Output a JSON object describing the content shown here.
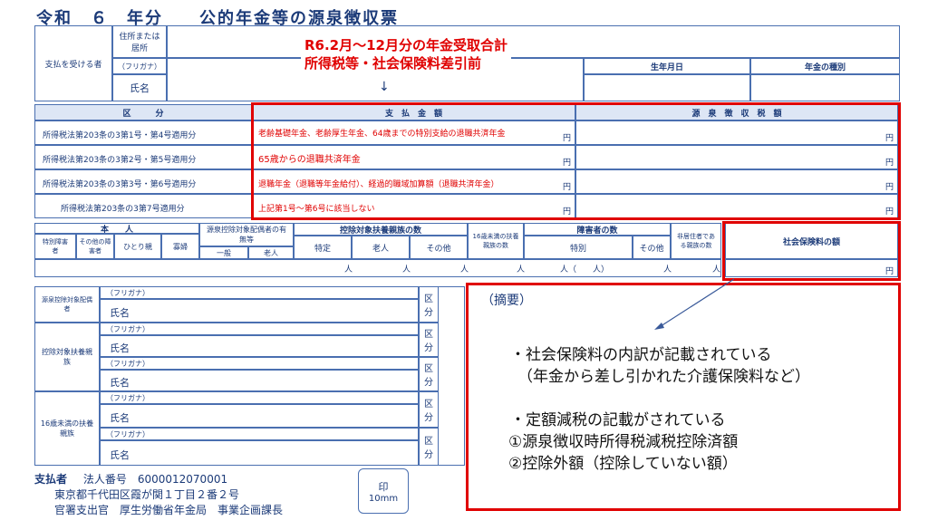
{
  "doc": {
    "title": "令和　６　年分　　公的年金等の源泉徴収票"
  },
  "payee": {
    "label": "支払を受ける者",
    "address_label": "住所または居所",
    "furigana_label": "（フリガナ）",
    "name_label": "氏名",
    "birth_label": "生年月日",
    "type_label": "年金の種別"
  },
  "note": {
    "line1": "R6.2月～12月分の年金受取合計",
    "line2": "所得税等・社会保険料差引前",
    "arrow": "↓"
  },
  "table": {
    "kubun": "区　　　分",
    "payment": "支　払　金　額",
    "withholding": "源　泉　徴　収　税　額",
    "yen": "円",
    "rows": [
      {
        "label": "所得税法第203条の3第1号・第4号適用分",
        "content": "老齢基礎年金、老齢厚生年金、64歳までの特別支給の退職共済年金"
      },
      {
        "label": "所得税法第203条の3第2号・第5号適用分",
        "content": "65歳からの退職共済年金"
      },
      {
        "label": "所得税法第203条の3第3号・第6号適用分",
        "content": "退職年金（退職等年金給付）、経過的職域加算額（退職共済年金）"
      },
      {
        "label": "所得税法第203条の3第7号適用分",
        "content": "上記第1号～第6号に該当しない"
      }
    ]
  },
  "deps": {
    "honnin": "本　　人",
    "tokubetsu": "特別障害者",
    "sonota": "その他の障害者",
    "hitorioya": "ひとり親",
    "kafu": "寡婦",
    "spouse": "源泉控除対象配偶者の有無等",
    "ippan": "一般",
    "rojin": "老人",
    "fuyo": "控除対象扶養親族の数",
    "tokutei": "特定",
    "rojin2": "老人",
    "sonota2": "その他",
    "under16": "16歳未満の扶養親族の数",
    "shogai": "障害者の数",
    "tokubetsu2": "特別",
    "sonota3": "その他",
    "hikyoju": "非居住者である親族の数",
    "shakai": "社会保険料の額",
    "nin": "人",
    "nin_paren": "人（　　人）"
  },
  "persons": {
    "furigana": "（フリガナ）",
    "name": "氏名",
    "kubun": "区分",
    "spouse_label": "源泉控除対象配偶者",
    "fuyo_label": "控除対象扶養親族",
    "under16_label": "16歳未満の扶養親族"
  },
  "summary": {
    "title": "（摘要）",
    "b1": "・社会保険料の内訳が記載されている",
    "b1sub": "（年金から差し引かれた介護保険料など）",
    "b2": "・定額減税の記載がされている",
    "b2a": "①源泉徴収時所得税減税控除済額",
    "b2b": "②控除外額（控除していない額）"
  },
  "payer": {
    "label": "支払者",
    "corp": "法人番号　6000012070001",
    "address": "東京都千代田区霞が関１丁目２番２号",
    "officer": "官署支出官　厚生労働省年金局　事業企画課長",
    "seal": "印",
    "seal_size": "10mm"
  }
}
